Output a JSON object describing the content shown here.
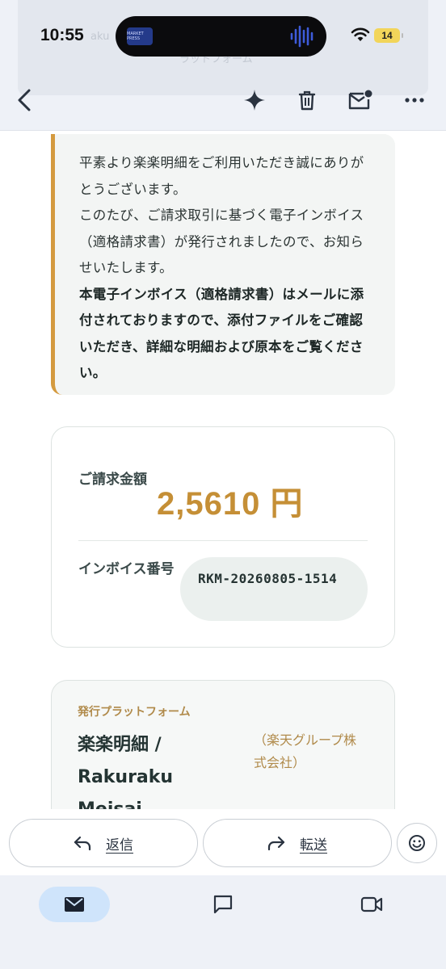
{
  "status_bar": {
    "time": "10:55",
    "battery": "14",
    "island_badge": "MARKET PRESS"
  },
  "background_ghost": {
    "left_text": "aku",
    "center_text": "ラットフォーム"
  },
  "toolbar": {
    "back_icon": "chevron-left-icon",
    "spark_icon": "sparkle-icon",
    "trash_icon": "trash-icon",
    "mail_icon": "mark-unread-icon",
    "more_icon": "more-icon"
  },
  "notice": {
    "line1": "平素より楽楽明細をご利用いただき誠にありがとうございます。",
    "line2": "このたび、ご請求取引に基づく電子インボイス（適格請求書）が発行されましたので、お知らせいたします。",
    "line3": "本電子インボイス（適格請求書）はメールに添付されておりますので、添付ファイルをご確認いただき、詳細な明細および原本をご覧ください。",
    "accent_color": "#d49a3f"
  },
  "billing": {
    "amount_label": "ご請求金額",
    "amount_value": "2,5610 円",
    "invoice_label": "インボイス番号",
    "invoice_number": "RKM-20260805-1514",
    "amount_color": "#c58f36"
  },
  "platform": {
    "label": "発行プラットフォーム",
    "name": "楽楽明細 / Rakuraku Meisai",
    "company": "（楽天グループ株式会社）"
  },
  "reply_bar": {
    "reply_label": "返信",
    "forward_label": "転送"
  },
  "bottom_nav": {
    "mail_icon": "mail-icon",
    "chat_icon": "chat-icon",
    "video_icon": "video-icon",
    "active_color": "#cfe4fb"
  }
}
